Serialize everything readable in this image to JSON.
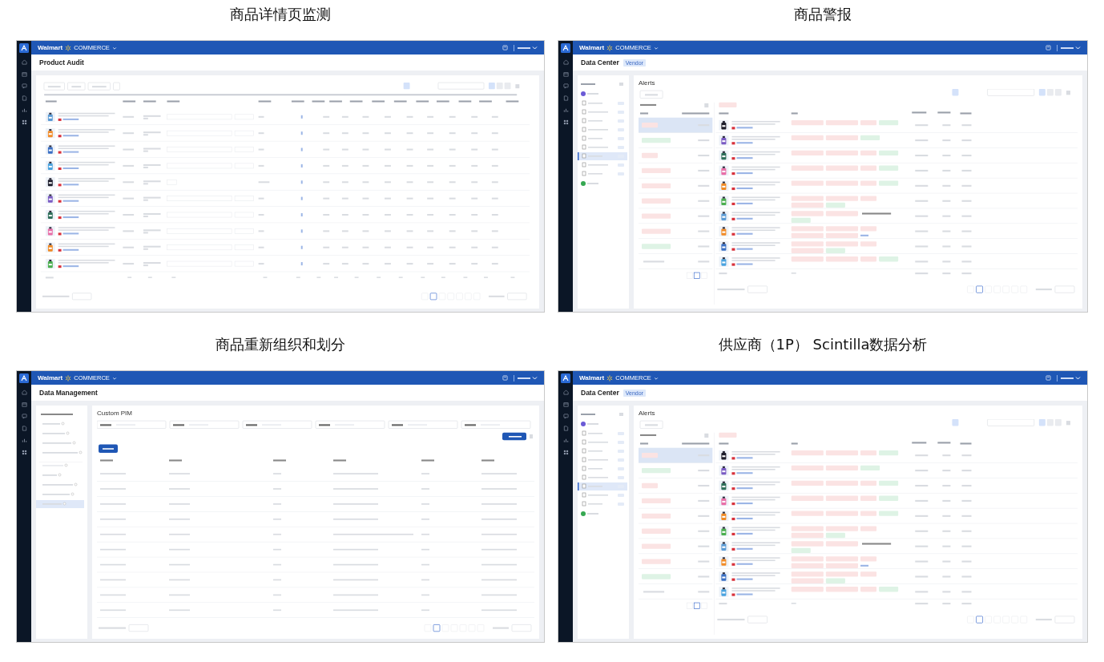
{
  "panels": [
    {
      "caption": "商品详情页监测",
      "kind": "audit",
      "screen": {
        "brand": "Walmart",
        "product": "COMMERCE",
        "title": "Product Audit"
      }
    },
    {
      "caption": "商品警报",
      "kind": "alerts",
      "screen": {
        "brand": "Walmart",
        "product": "COMMERCE",
        "title": "Data Center",
        "tag": "Vendor",
        "section_title": "Alerts"
      }
    },
    {
      "caption": "商品重新组织和划分",
      "kind": "management",
      "screen": {
        "brand": "Walmart",
        "product": "COMMERCE",
        "title": "Data Management",
        "section_title": "Custom PIM"
      }
    },
    {
      "caption": "供应商（1P） Scintilla数据分析",
      "kind": "alerts",
      "screen": {
        "brand": "Walmart",
        "product": "COMMERCE",
        "title": "Data Center",
        "tag": "Vendor",
        "section_title": "Alerts"
      }
    }
  ]
}
